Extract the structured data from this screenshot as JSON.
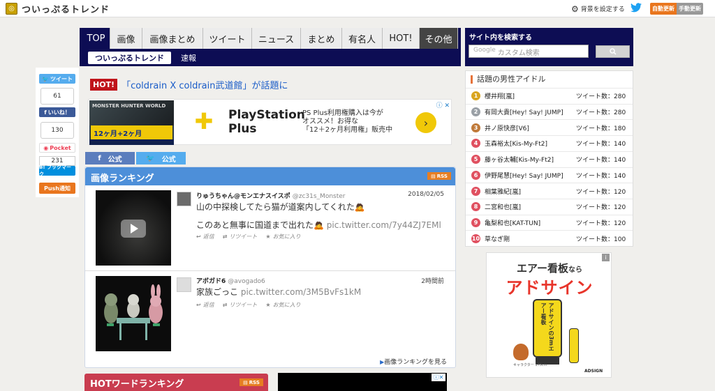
{
  "header": {
    "site_title": "ついっぷるトレンド",
    "bg_setting": "背景を設定する",
    "auto_update": "自動更新",
    "manual_update": "手動更新"
  },
  "nav": {
    "tabs": [
      "TOP",
      "画像",
      "画像まとめ",
      "ツイート",
      "ニュース",
      "まとめ",
      "有名人",
      "HOT!",
      "その他"
    ],
    "sub_active": "ついっぷるトレンド",
    "sub_link": "速報"
  },
  "share": {
    "tweet_label": "ツイート",
    "tweet_count": "61",
    "like_label": "いいね！",
    "like_count": "130",
    "pocket_label": "Pocket",
    "hatena_count": "231",
    "hatena_label": "B! ブックマーク",
    "push_label": "Push通知"
  },
  "hot": {
    "badge": "HOT!",
    "title": "「coldrain X coldrain武道館」が話題に"
  },
  "ad1": {
    "game_title": "MONSTER HUNTER WORLD",
    "plus_banner": "12ヶ月+2ヶ月",
    "brand": "PlayStation\nPlus",
    "copy": "PS Plus利用権購入は今が\nオススメ！お得な\n「12＋2ヶ月利用権」販売中",
    "info": "ⓘ ✕"
  },
  "official": {
    "fb_label": "公式",
    "tw_label": "公式"
  },
  "image_ranking": {
    "heading": "画像ランキング",
    "rss": "RSS",
    "tweets": [
      {
        "user": "りゅうちゃん@モンエナスイスポ",
        "handle": "@zc31s_Monster",
        "date": "2018/02/05",
        "text": "山の中探検してたら猫が道案内してくれた🙇",
        "text2": "このあと無事に国道まで出れた🙇",
        "pic": "pic.twitter.com/7y44ZJ7EMl",
        "reply": "返信",
        "retweet": "リツイート",
        "fav": "お気に入り"
      },
      {
        "user": "アボガド6",
        "handle": "@avogado6",
        "date": "2時間前",
        "text": "家族ごっこ",
        "pic": "pic.twitter.com/3M5BvFs1kM",
        "reply": "返信",
        "retweet": "リツイート",
        "fav": "お気に入り"
      }
    ],
    "more": "画像ランキングを見る"
  },
  "hotword": {
    "heading": "HOTワードランキング",
    "rss": "RSS"
  },
  "search": {
    "title": "サイト内を検索する",
    "google": "Google",
    "placeholder": "カスタム検索"
  },
  "idols": {
    "title": "話題の男性アイドル",
    "count_label": "ツイート数：",
    "items": [
      {
        "rank": "1",
        "name": "櫻井翔[嵐]",
        "count": "280"
      },
      {
        "rank": "2",
        "name": "有岡大貴[Hey! Say! JUMP]",
        "count": "280"
      },
      {
        "rank": "3",
        "name": "井ノ原快彦[V6]",
        "count": "180"
      },
      {
        "rank": "4",
        "name": "玉森裕太[Kis-My-Ft2]",
        "count": "140"
      },
      {
        "rank": "5",
        "name": "藤ヶ谷太輔[Kis-My-Ft2]",
        "count": "140"
      },
      {
        "rank": "6",
        "name": "伊野尾慧[Hey! Say! JUMP]",
        "count": "140"
      },
      {
        "rank": "7",
        "name": "相葉雅紀[嵐]",
        "count": "120"
      },
      {
        "rank": "8",
        "name": "二宮和也[嵐]",
        "count": "120"
      },
      {
        "rank": "9",
        "name": "亀梨和也[KAT-TUN]",
        "count": "120"
      },
      {
        "rank": "10",
        "name": "草なぎ剛",
        "count": "100"
      }
    ]
  },
  "ad2": {
    "line1": "エアー看板",
    "line1_suffix": "なら",
    "line2": "アドサイン",
    "balloon": "アドサインの3mエアー看板",
    "caption": "キャラクター 175cm",
    "brand": "ADSIGN",
    "info": "i"
  },
  "colors": {
    "nav_bg": "#0d0d54",
    "ranking_head": "#4d8fd9",
    "hotword_head": "#c93d50",
    "hot_badge": "#c0141a",
    "link": "#1a5cc8"
  }
}
